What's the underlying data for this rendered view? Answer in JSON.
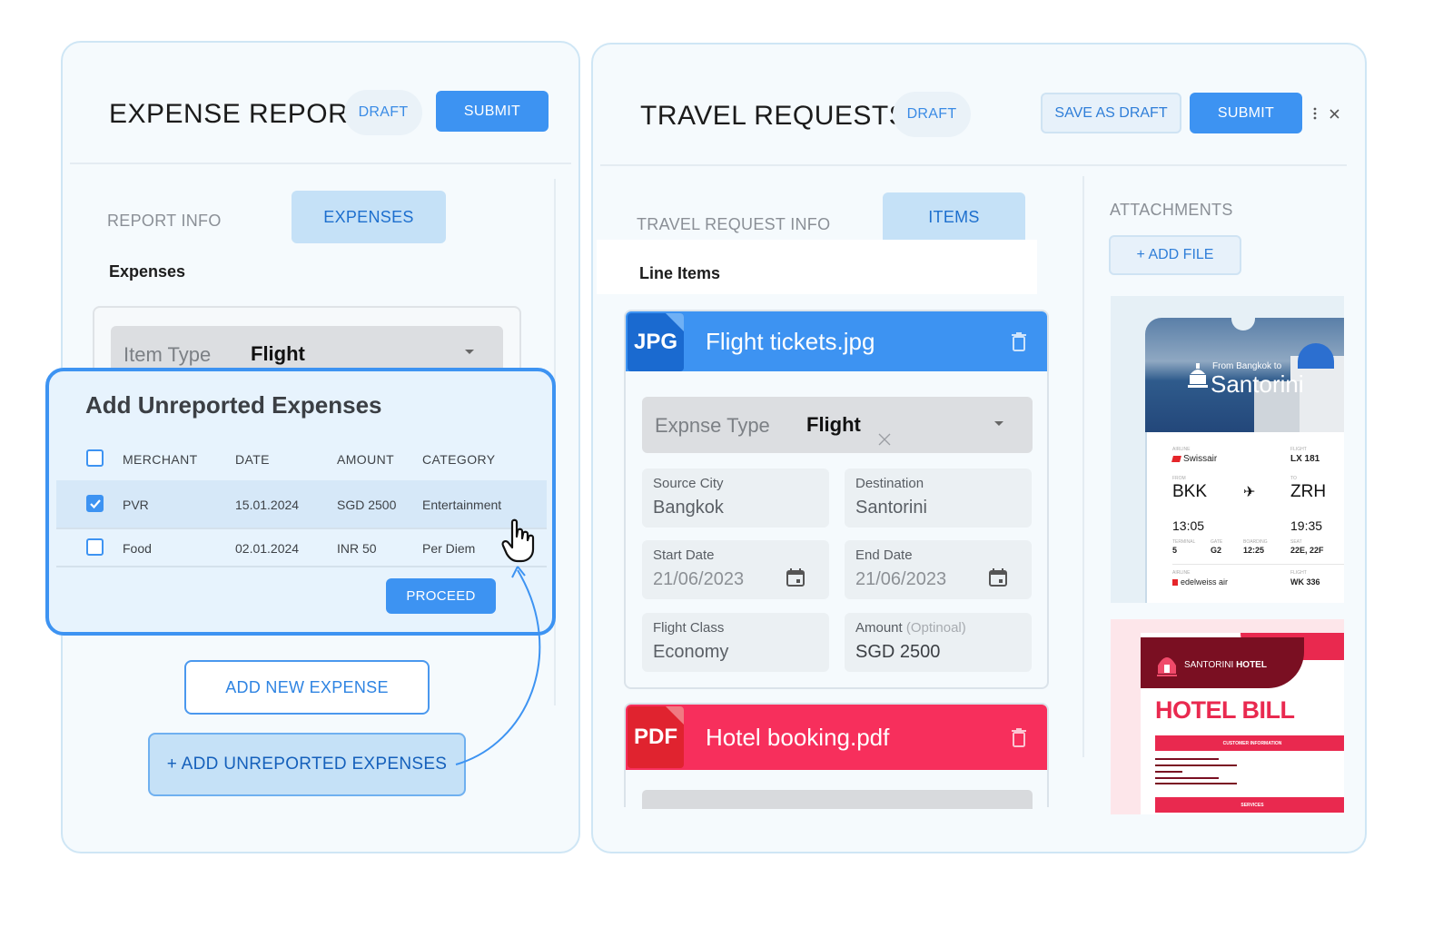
{
  "expense_report": {
    "title": "EXPENSE REPORT",
    "status": "DRAFT",
    "submit_label": "SUBMIT",
    "tabs": [
      {
        "label": "REPORT INFO",
        "active": false
      },
      {
        "label": "EXPENSES",
        "active": true
      }
    ],
    "section_label": "Expenses",
    "item_type": {
      "label": "Item Type",
      "value": "Flight"
    },
    "add_new_label": "ADD NEW EXPENSE",
    "add_unreported_label": "+ ADD UNREPORTED EXPENSES"
  },
  "unreported_modal": {
    "title": "Add Unreported Expenses",
    "columns": [
      "MERCHANT",
      "DATE",
      "AMOUNT",
      "CATEGORY"
    ],
    "rows": [
      {
        "checked": true,
        "merchant": "PVR",
        "date": "15.01.2024",
        "amount": "SGD 2500",
        "category": "Entertainment"
      },
      {
        "checked": false,
        "merchant": "Food",
        "date": "02.01.2024",
        "amount": "INR 50",
        "category": "Per Diem"
      }
    ],
    "proceed_label": "PROCEED"
  },
  "travel_requests": {
    "title": "TRAVEL REQUESTS",
    "status": "DRAFT",
    "save_draft_label": "SAVE AS DRAFT",
    "submit_label": "SUBMIT",
    "tabs": [
      {
        "label": "TRAVEL REQUEST INFO",
        "active": false
      },
      {
        "label": "ITEMS",
        "active": true
      }
    ],
    "section_label": "Line Items",
    "line_items": [
      {
        "file_type": "JPG",
        "file_name": "Flight tickets.jpg",
        "color": "#3d93f2",
        "expense_type": {
          "label": "Expnse Type",
          "value": "Flight"
        },
        "fields": {
          "source_city": {
            "label": "Source City",
            "value": "Bangkok"
          },
          "destination": {
            "label": "Destination",
            "value": "Santorini"
          },
          "start_date": {
            "label": "Start Date",
            "value": "21/06/2023"
          },
          "end_date": {
            "label": "End Date",
            "value": "21/06/2023"
          },
          "flight_class": {
            "label": "Flight Class",
            "value": "Economy"
          },
          "amount": {
            "label": "Amount",
            "optional": "(Optinoal)",
            "value": "SGD 2500"
          }
        }
      },
      {
        "file_type": "PDF",
        "file_name": "Hotel booking.pdf",
        "color": "#f72f5c"
      }
    ],
    "attachments": {
      "title": "ATTACHMENTS",
      "add_file_label": "+ ADD FILE",
      "ticket": {
        "subtitle": "From Bangkok to",
        "destination": "Santorini",
        "airline_label": "AIRLINE",
        "airline": "Swissair",
        "flight_label": "FLIGHT",
        "flight": "LX 181",
        "from_label": "FROM",
        "from": "BKK",
        "to_label": "TO",
        "to": "ZRH",
        "depart_time": "13:05",
        "arrive_time": "19:35",
        "terminal_label": "TERMINAL",
        "terminal": "5",
        "gate_label": "GATE",
        "gate": "G2",
        "boarding_label": "BOARDING",
        "boarding": "12:25",
        "seat_label": "SEAT",
        "seat": "22E, 22F",
        "airline2": "edelweiss air",
        "flight2": "WK 336"
      },
      "hotel_bill": {
        "brand_light": "SANTORINI",
        "brand_bold": "HOTEL",
        "title": "HOTEL BILL",
        "section1": "CUSTOMER INFORMATION",
        "section2": "SERVICES"
      }
    }
  }
}
